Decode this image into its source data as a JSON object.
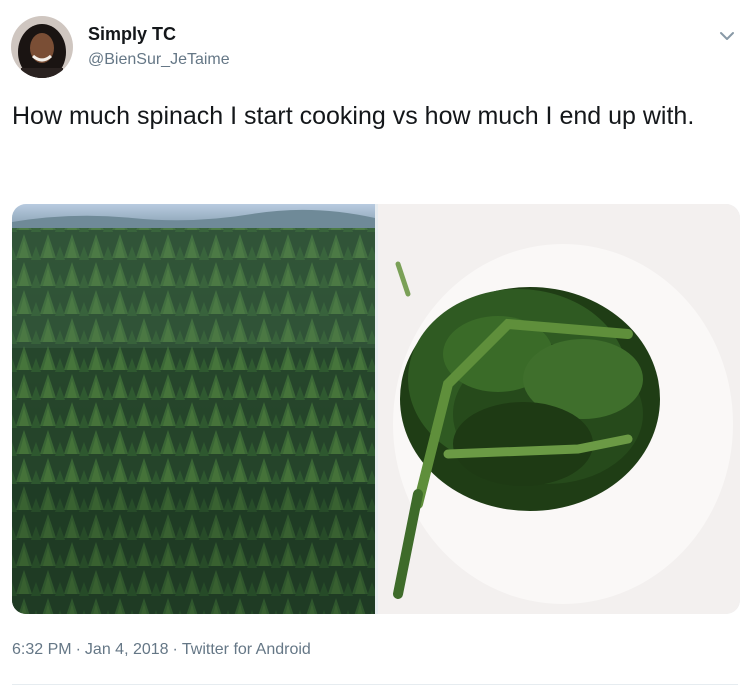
{
  "author": {
    "display_name": "Simply TC",
    "handle": "@BienSur_JeTaime"
  },
  "tweet": {
    "text": "How much spinach I start cooking vs how much I end up with."
  },
  "footer": {
    "time": "6:32 PM",
    "separator": "·",
    "date": "Jan 4, 2018",
    "source": "Twitter for Android"
  },
  "colors": {
    "text_primary": "#14171a",
    "text_secondary": "#657786",
    "forest_dark": "#1c3520",
    "forest_light": "#4a7a3c",
    "spinach": "#2f5a22",
    "plate": "#f3f0ef"
  },
  "icons": {
    "menu": "chevron-down-icon"
  }
}
